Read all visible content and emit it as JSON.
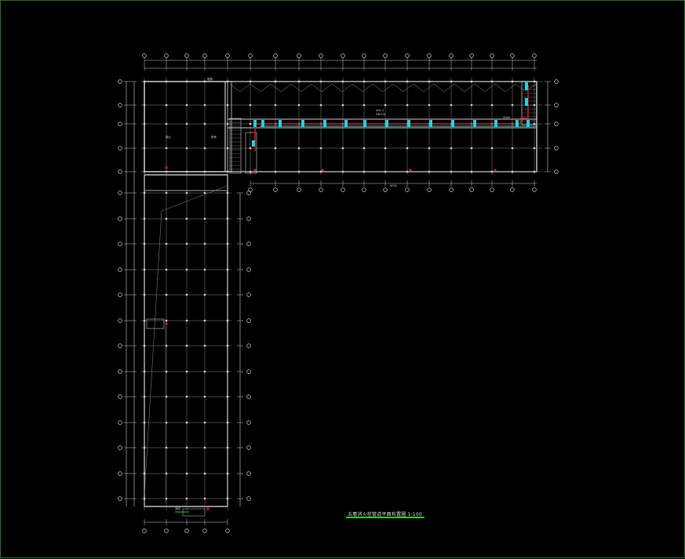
{
  "drawing": {
    "title": "五層消火栓管道平面布置圖 1:100",
    "colors": {
      "background": "#000000",
      "frame": "#2d6b2d",
      "walls": "#c8c8c8",
      "grid": "#8a8a8a",
      "pipe_red": "#e01818",
      "pipe_cyan": "#19d6e6",
      "title_underline": "#19d219"
    },
    "annotations": {
      "pipe_label_1": "XHL-1",
      "pipe_label_2": "DN100",
      "stair_label": "樓梯",
      "room_label_1": "辦公",
      "room_label_2": "庫房",
      "hydrant_label": "SN65",
      "bottom_label": "消防",
      "dim_label": "6000"
    }
  }
}
